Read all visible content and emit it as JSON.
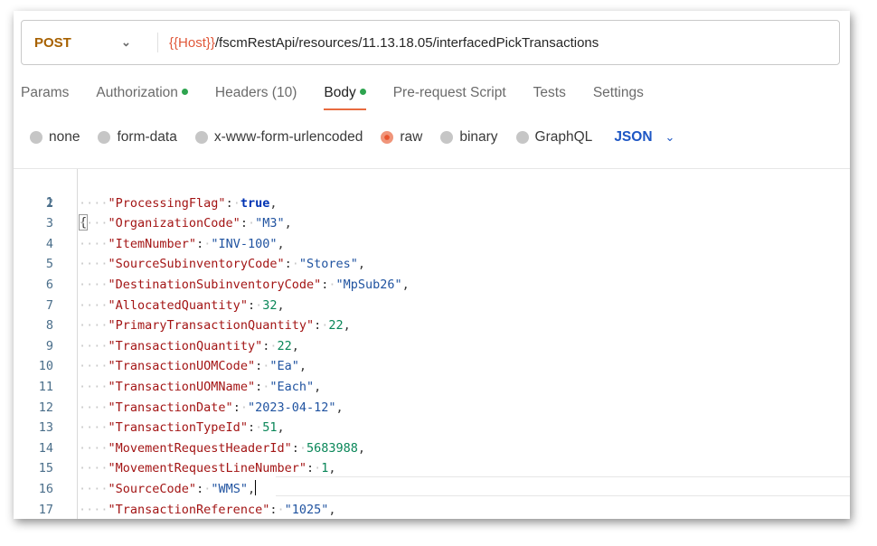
{
  "request": {
    "method": "POST",
    "url_var": "{{Host}}",
    "url_path": "/fscmRestApi/resources/11.13.18.05/interfacedPickTransactions"
  },
  "tabs": [
    {
      "label": "Params",
      "active": false,
      "dot": false
    },
    {
      "label": "Authorization",
      "active": false,
      "dot": true
    },
    {
      "label": "Headers",
      "count": "(10)",
      "active": false,
      "dot": false
    },
    {
      "label": "Body",
      "active": true,
      "dot": true
    },
    {
      "label": "Pre-request Script",
      "active": false,
      "dot": false
    },
    {
      "label": "Tests",
      "active": false,
      "dot": false
    },
    {
      "label": "Settings",
      "active": false,
      "dot": false
    }
  ],
  "body_types": [
    {
      "label": "none",
      "selected": false
    },
    {
      "label": "form-data",
      "selected": false
    },
    {
      "label": "x-www-form-urlencoded",
      "selected": false
    },
    {
      "label": "raw",
      "selected": true
    },
    {
      "label": "binary",
      "selected": false
    },
    {
      "label": "GraphQL",
      "selected": false
    }
  ],
  "format": "JSON",
  "editor": {
    "open_brace": "{",
    "lines": [
      {
        "key": "ProcessingFlag",
        "value": "true",
        "type": "bool"
      },
      {
        "key": "OrganizationCode",
        "value": "M3",
        "type": "str"
      },
      {
        "key": "ItemNumber",
        "value": "INV-100",
        "type": "str"
      },
      {
        "key": "SourceSubinventoryCode",
        "value": "Stores",
        "type": "str"
      },
      {
        "key": "DestinationSubinventoryCode",
        "value": "MpSub26",
        "type": "str"
      },
      {
        "key": "AllocatedQuantity",
        "value": "32",
        "type": "num"
      },
      {
        "key": "PrimaryTransactionQuantity",
        "value": "22",
        "type": "num"
      },
      {
        "key": "TransactionQuantity",
        "value": "22",
        "type": "num"
      },
      {
        "key": "TransactionUOMCode",
        "value": "Ea",
        "type": "str"
      },
      {
        "key": "TransactionUOMName",
        "value": "Each",
        "type": "str"
      },
      {
        "key": "TransactionDate",
        "value": "2023-04-12",
        "type": "str"
      },
      {
        "key": "TransactionTypeId",
        "value": "51",
        "type": "num"
      },
      {
        "key": "MovementRequestHeaderId",
        "value": "5683988",
        "type": "num"
      },
      {
        "key": "MovementRequestLineNumber",
        "value": "1",
        "type": "num"
      },
      {
        "key": "SourceCode",
        "value": "WMS",
        "type": "str",
        "cursor": true
      },
      {
        "key": "TransactionReference",
        "value": "1025",
        "type": "str"
      }
    ]
  }
}
